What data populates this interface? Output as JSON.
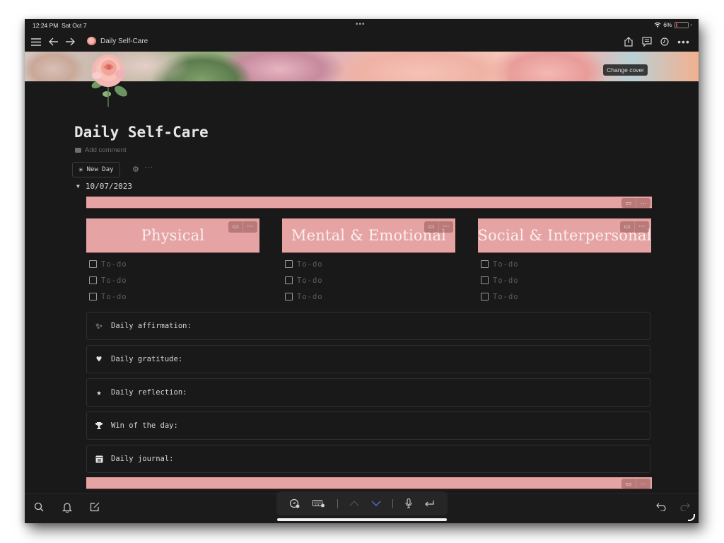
{
  "status_bar": {
    "time": "12:24 PM",
    "date": "Sat Oct 7",
    "multitask_dots": "•••",
    "wifi_icon": "wifi-icon",
    "battery_percent": "6%"
  },
  "nav": {
    "menu_icon": "hamburger-icon",
    "back_icon": "arrow-left-icon",
    "forward_icon": "arrow-right-icon",
    "page_icon": "rose-icon",
    "page_name": "Daily Self-Care",
    "right_icons": [
      "share-icon",
      "comments-icon",
      "history-icon",
      "more-icon"
    ]
  },
  "cover": {
    "change_cover_label": "Change cover"
  },
  "page": {
    "title": "Daily Self-Care",
    "add_comment": "Add comment",
    "new_day_button": "New Day",
    "toggle_date": "10/07/2023",
    "accent_color": "#e5a3a3",
    "columns": [
      {
        "heading": "Physical",
        "todos": [
          "To-do",
          "To-do",
          "To-do"
        ]
      },
      {
        "heading": "Mental & Emotional",
        "todos": [
          "To-do",
          "To-do",
          "To-do"
        ]
      },
      {
        "heading": "Social & Interpersonal",
        "todos": [
          "To-do",
          "To-do",
          "To-do"
        ]
      }
    ],
    "callouts": [
      {
        "icon": "sparkles-icon",
        "label": "Daily affirmation:"
      },
      {
        "icon": "heart-icon",
        "label": "Daily gratitude:"
      },
      {
        "icon": "star-icon",
        "label": "Daily reflection:"
      },
      {
        "icon": "trophy-icon",
        "label": "Win of the day:"
      },
      {
        "icon": "journal-icon",
        "label": "Daily journal:"
      }
    ]
  },
  "bottom_bar": {
    "left_icons": [
      "search-icon",
      "bell-icon",
      "compose-icon"
    ],
    "keyboard_tools": [
      "undo-history-icon",
      "keyboard-icon",
      "chevron-up-icon",
      "chevron-down-icon",
      "microphone-icon",
      "return-icon"
    ],
    "right_icons": [
      "undo-icon",
      "redo-icon"
    ]
  }
}
